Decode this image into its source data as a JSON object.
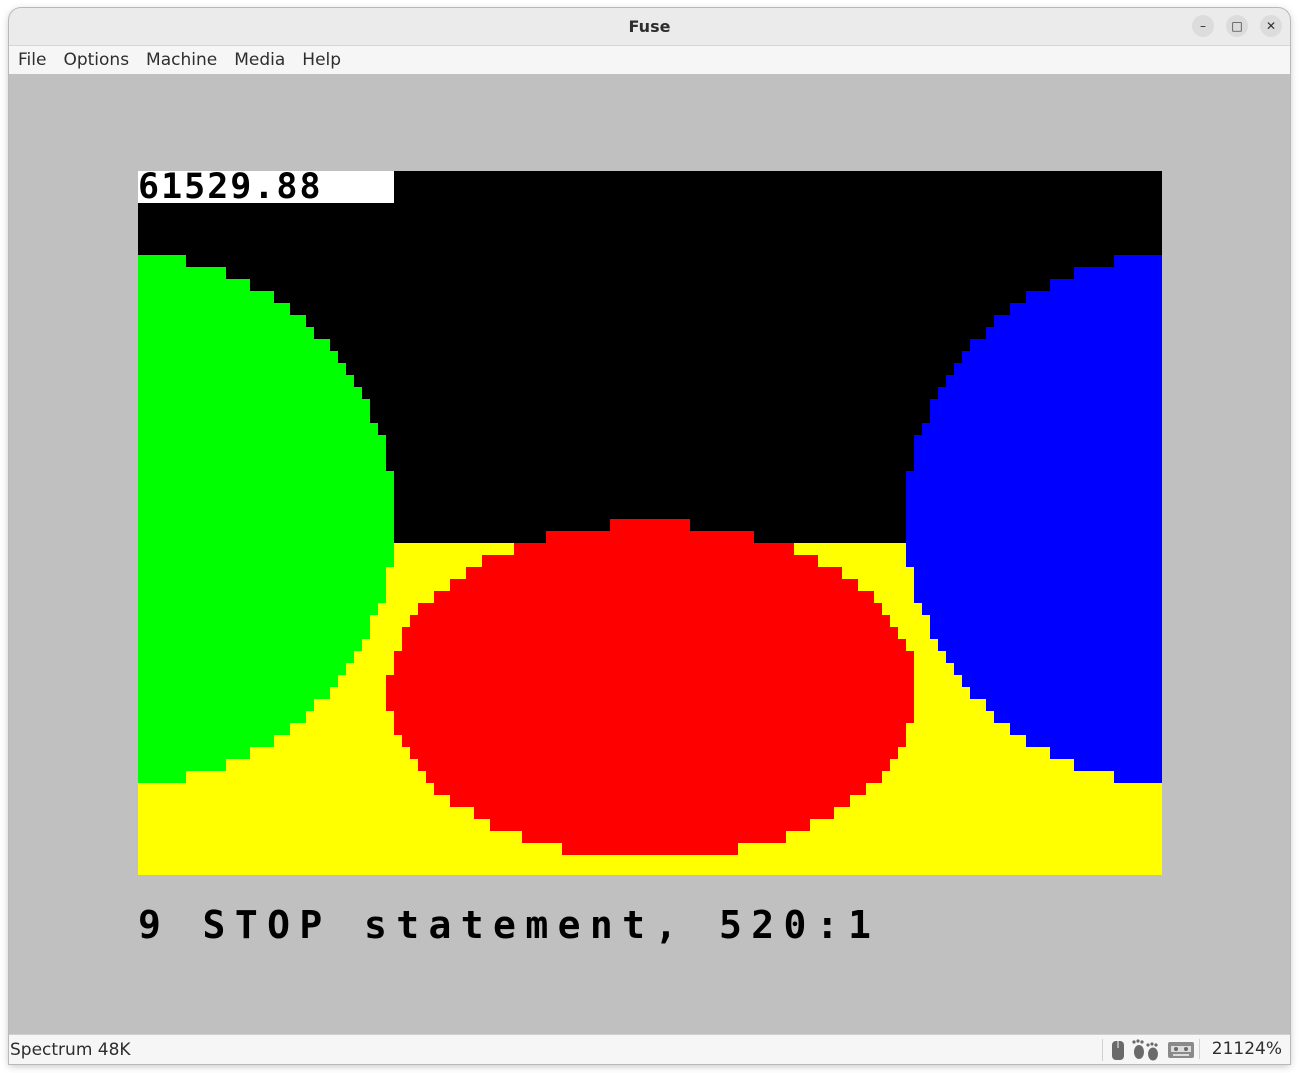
{
  "window": {
    "title": "Fuse",
    "controls": {
      "minimize": "–",
      "maximize": "□",
      "close": "✕"
    }
  },
  "menubar": {
    "items": [
      {
        "label": "File"
      },
      {
        "label": "Options"
      },
      {
        "label": "Machine"
      },
      {
        "label": "Media"
      },
      {
        "label": "Help"
      }
    ]
  },
  "emulator": {
    "screen_palette": {
      "black": "#000000",
      "green": "#00ff00",
      "blue": "#0000ff",
      "red": "#ff0000",
      "yellow": "#ffff00",
      "white": "#ffffff",
      "border": "#c0c0c0"
    },
    "timer_readout": "61529.88",
    "basic_report": "9 STOP statement, 520:1",
    "scene": {
      "description": "Ray-traced three spheres on yellow floor over black sky",
      "spheres": [
        {
          "name": "green-sphere",
          "color": "green"
        },
        {
          "name": "red-sphere",
          "color": "red"
        },
        {
          "name": "blue-sphere",
          "color": "blue"
        }
      ],
      "floor_color": "yellow",
      "sky_color": "black"
    }
  },
  "statusbar": {
    "machine": "Spectrum 48K",
    "icons": [
      "mouse-icon",
      "footprints-icon",
      "cassette-icon"
    ],
    "zoom": "21124%"
  }
}
